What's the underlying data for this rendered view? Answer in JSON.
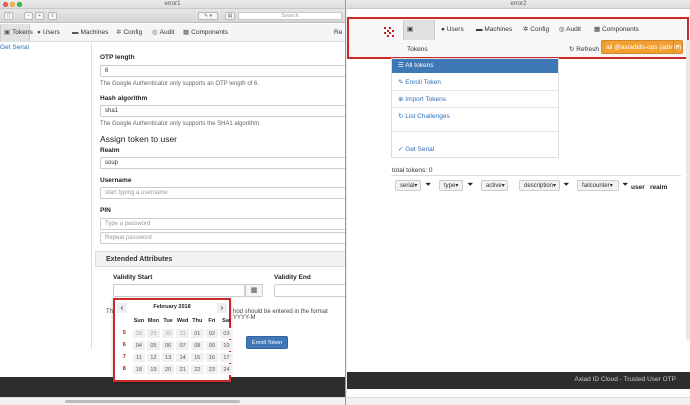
{
  "window1": {
    "title": "error1",
    "search_placeholder": "Search",
    "nav": [
      "Tokens",
      "Users",
      "Machines",
      "Config",
      "Audit",
      "Components",
      "Re"
    ],
    "left_link": "Get Serial",
    "form": {
      "otp_length_label": "OTP length",
      "otp_length_value": "6",
      "otp_help": "The Google Authenticator only supports an OTP length of 6.",
      "hash_label": "Hash algorithm",
      "hash_value": "sha1",
      "hash_help": "The Google Authenticator only supports the SHA1 algorithm.",
      "assign_heading": "Assign token to user",
      "realm_label": "Realm",
      "realm_value": "soup",
      "username_label": "Username",
      "username_placeholder": "start typing a username",
      "pin_label": "PIN",
      "pin_placeholder": "Type a password",
      "repeat_placeholder": "Repeat password",
      "extended_heading": "Extended Attributes",
      "validity_start_label": "Validity Start",
      "validity_end_label": "Validity End",
      "truncated_text_left": "Th",
      "truncated_text_right": "hod should be entered in the format YYYY-M",
      "enroll_button": "Enroll Token"
    },
    "datepicker": {
      "prev": "‹",
      "next": "›",
      "month": "February 2018",
      "headers": [
        "",
        "Sun",
        "Mon",
        "Tue",
        "Wed",
        "Thu",
        "Fri",
        "Sat"
      ],
      "weeks": [
        {
          "wk": "5",
          "days": [
            "28",
            "29",
            "30",
            "31",
            "01",
            "02",
            "03"
          ],
          "old": [
            true,
            true,
            true,
            true,
            false,
            false,
            false
          ]
        },
        {
          "wk": "6",
          "days": [
            "04",
            "05",
            "06",
            "07",
            "08",
            "09",
            "10"
          ],
          "old": [
            false,
            false,
            false,
            false,
            false,
            false,
            false
          ]
        },
        {
          "wk": "7",
          "days": [
            "11",
            "12",
            "13",
            "14",
            "15",
            "16",
            "17"
          ],
          "old": [
            false,
            false,
            false,
            false,
            false,
            false,
            false
          ]
        },
        {
          "wk": "8",
          "days": [
            "18",
            "19",
            "20",
            "21",
            "22",
            "23",
            "24"
          ],
          "old": [
            false,
            false,
            false,
            false,
            false,
            false,
            false
          ]
        }
      ]
    }
  },
  "window2": {
    "title": "error2",
    "nav": [
      "Tokens",
      "Users",
      "Machines",
      "Config",
      "Audit",
      "Components"
    ],
    "refresh": "Refresh",
    "user_button": "ali @axiadids-ops (admin)",
    "sidebar": {
      "active": "All tokens",
      "items": [
        "Enroll Token",
        "Import Tokens",
        "List Challenges",
        "Get Serial"
      ]
    },
    "total_tokens": "total tokens: 0",
    "columns": [
      "serial",
      "type",
      "active",
      "description",
      "failcounter",
      "user",
      "realm"
    ],
    "footer": "Axiad ID Cloud - Trusted User OTP"
  },
  "colors": {
    "highlight": "#cc2a2a",
    "primary": "#3f78b6",
    "user_button": "#f0a030",
    "footer": "#2e2e2e"
  }
}
